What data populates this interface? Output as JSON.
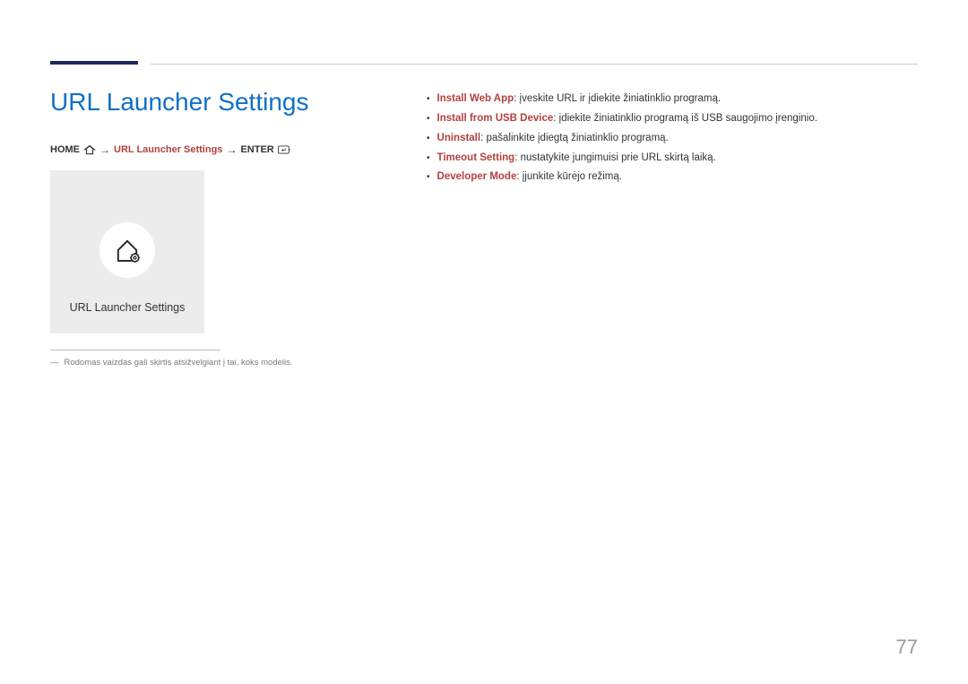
{
  "heading": "URL Launcher Settings",
  "breadcrumb": {
    "home": "HOME",
    "middle": "URL Launcher Settings",
    "enter": "ENTER"
  },
  "tile": {
    "label": "URL Launcher Settings"
  },
  "footnote": "Rodomas vaizdas gali skirtis atsižvelgiant į tai, koks modelis.",
  "features": [
    {
      "term": "Install Web App",
      "desc": ": įveskite URL ir įdiekite žiniatinklio programą."
    },
    {
      "term": "Install from USB Device",
      "desc": ": įdiekite žiniatinklio programą iš USB saugojimo įrenginio."
    },
    {
      "term": "Uninstall",
      "desc": ": pašalinkite įdiegtą žiniatinklio programą."
    },
    {
      "term": "Timeout Setting",
      "desc": ": nustatykite jungimuisi prie URL skirtą laiką."
    },
    {
      "term": "Developer Mode",
      "desc": ": įjunkite kūrėjo režimą."
    }
  ],
  "page_number": "77"
}
